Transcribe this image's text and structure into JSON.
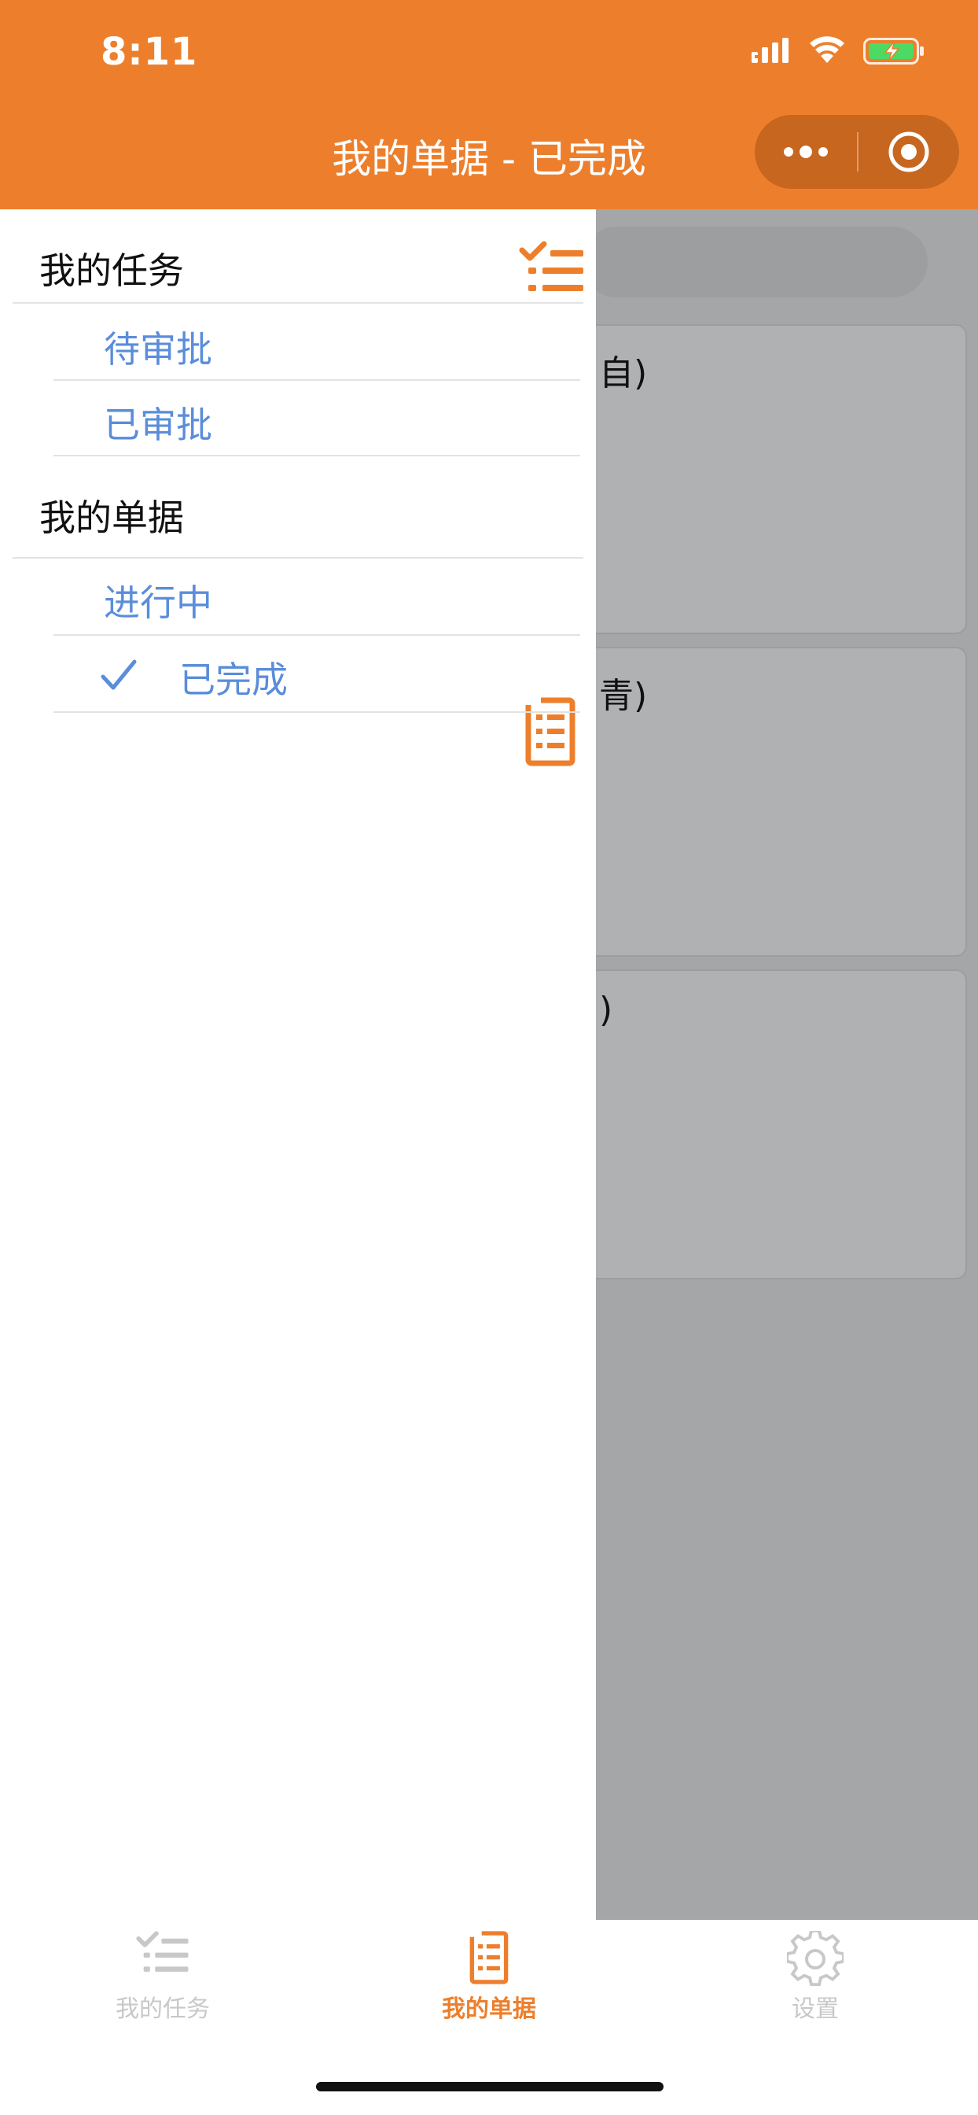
{
  "status_bar": {
    "time": "8:11"
  },
  "nav": {
    "title": "我的单据 - 已完成"
  },
  "background_cards": [
    {
      "visible_fragment": "自)"
    },
    {
      "visible_fragment": "青)"
    },
    {
      "visible_fragment": ")"
    }
  ],
  "drawer": {
    "tasks_section": {
      "title": "我的任务",
      "icon": "task-list-icon",
      "items": [
        {
          "label": "待审批",
          "selected": false
        },
        {
          "label": "已审批",
          "selected": false
        }
      ]
    },
    "docs_section": {
      "title": "我的单据",
      "icon": "document-icon",
      "items": [
        {
          "label": "进行中",
          "selected": false
        },
        {
          "label": "已完成",
          "selected": true
        }
      ]
    }
  },
  "tabbar": {
    "tabs": [
      {
        "label": "我的任务",
        "icon": "task-list-icon",
        "active": false
      },
      {
        "label": "我的单据",
        "icon": "document-icon",
        "active": true
      },
      {
        "label": "设置",
        "icon": "gear-icon",
        "active": false
      }
    ]
  },
  "colors": {
    "accent": "#ED7F2C",
    "link": "#5A8DDA",
    "inactive": "#C8C8C8",
    "backdrop": "#A5A6A8"
  }
}
